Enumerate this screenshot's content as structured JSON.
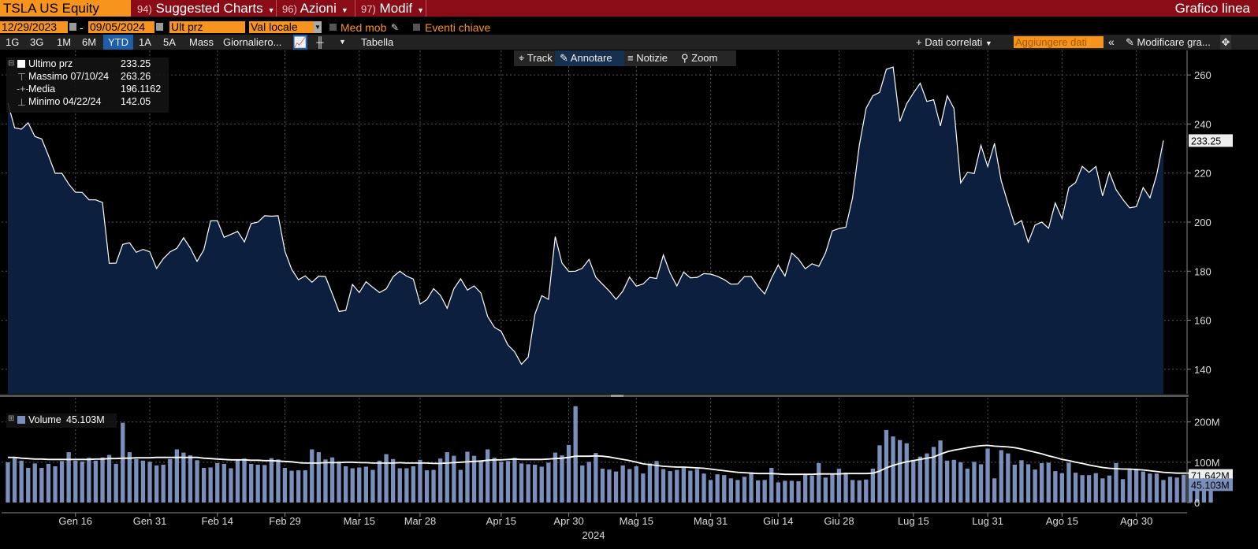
{
  "topbar": {
    "ticker": "TSLA US Equity",
    "menus": [
      {
        "num": "94)",
        "label": "Suggested Charts"
      },
      {
        "num": "96)",
        "label": "Azioni"
      },
      {
        "num": "97)",
        "label": "Modif"
      }
    ],
    "right_title": "Grafico linea"
  },
  "controls": {
    "start_date": "12/29/2023",
    "dash": "-",
    "end_date": "09/05/2024",
    "field": "Ult prz",
    "currency": "Val locale",
    "moving_avg": "Med mob",
    "key_events": "Eventi chiave"
  },
  "periods": [
    "1G",
    "3G",
    "1M",
    "6M",
    "YTD",
    "1A",
    "5A",
    "Mass"
  ],
  "selected_period": "YTD",
  "frequency": "Giornaliero...",
  "table_button": "Tabella",
  "related_data": "Dati correlati",
  "add_data_placeholder": "Aggiungere dati",
  "edit_chart": "Modificare gra...",
  "chart_tools": [
    "Track",
    "Annotare",
    "Notizie",
    "Zoom"
  ],
  "legend": {
    "last_label": "Ultimo prz",
    "last_value": "233.25",
    "high_label": "Massimo 07/10/24",
    "high_value": "263.26",
    "avg_label": "Media",
    "avg_value": "196.1162",
    "low_label": "Minimo 04/22/24",
    "low_value": "142.05"
  },
  "volume_legend": {
    "label": "Volume",
    "value": "45.103M"
  },
  "price_axis_ticks": [
    "260",
    "240",
    "220",
    "200",
    "180",
    "160",
    "140"
  ],
  "volume_axis_ticks": [
    "200M",
    "100M",
    "0"
  ],
  "x_ticks": [
    "Gen 16",
    "Gen 31",
    "Feb 14",
    "Feb 29",
    "Mar 15",
    "Mar 28",
    "Apr 15",
    "Apr 30",
    "Mag 15",
    "Mag 31",
    "Giu 14",
    "Giu 28",
    "Lug 15",
    "Lug 31",
    "Ago 15",
    "Ago 30"
  ],
  "x_year": "2024",
  "last_price_tag": "233.25",
  "volume_ma_tag": "71.642M",
  "volume_last_tag": "45.103M",
  "colors": {
    "area": "#0c1f3e",
    "line": "#ffffff",
    "bars": "#7b8fbd",
    "accent": "#f7941d",
    "topbar": "#8b0c16"
  },
  "chart_data": [
    {
      "type": "area",
      "series": [
        {
          "name": "Ultimo prz",
          "values": [
            248.5,
            238.4,
            237.9,
            240.5,
            234.9,
            233.9,
            227.2,
            219.9,
            219.9,
            215.5,
            212.2,
            212.1,
            209.1,
            209.1,
            208.0,
            183.2,
            183.3,
            190.9,
            191.6,
            187.7,
            188.9,
            187.9,
            181.1,
            185.1,
            187.9,
            189.3,
            193.6,
            189.4,
            184.0,
            188.7,
            200.5,
            200.5,
            193.8,
            195.0,
            196.2,
            191.9,
            199.4,
            200.0,
            202.6,
            202.4,
            202.6,
            188.1,
            180.7,
            176.5,
            178.1,
            175.5,
            178.0,
            177.8,
            170.8,
            163.6,
            164.0,
            174.6,
            171.3,
            175.7,
            173.4,
            171.3,
            172.8,
            177.7,
            180.0,
            178.0,
            176.8,
            166.6,
            168.4,
            172.9,
            170.2,
            164.9,
            172.8,
            176.9,
            172.3,
            174.0,
            171.1,
            161.5,
            157.1,
            155.5,
            149.9,
            147.1,
            142.05,
            145.0,
            162.5,
            170.0,
            168.5,
            194.1,
            183.3,
            179.9,
            180.0,
            181.2,
            184.8,
            177.5,
            174.7,
            171.9,
            168.5,
            171.9,
            177.6,
            173.9,
            174.8,
            177.5,
            177.0,
            186.6,
            179.2,
            174.0,
            179.6,
            177.3,
            177.5,
            179.0,
            178.8,
            177.9,
            176.6,
            174.7,
            174.8,
            177.8,
            177.8,
            173.8,
            170.7,
            177.2,
            182.5,
            178.0,
            187.4,
            184.9,
            181.0,
            183.0,
            182.0,
            187.4,
            196.4,
            197.4,
            197.9,
            209.9,
            231.3,
            246.4,
            251.5,
            252.9,
            262.3,
            263.26,
            241.0,
            248.2,
            252.6,
            256.6,
            249.2,
            249.9,
            239.2,
            251.5,
            246.4,
            215.99,
            220.3,
            219.8,
            231.3,
            222.6,
            232.1,
            216.9,
            207.7,
            198.9,
            200.6,
            191.8,
            198.8,
            200.0,
            197.5,
            207.8,
            201.4,
            214.1,
            216.1,
            222.7,
            220.3,
            222.7,
            210.7,
            220.3,
            213.2,
            209.2,
            205.8,
            206.3,
            214.1,
            209.9,
            219.2,
            233.25
          ]
        }
      ],
      "ylim": [
        130,
        270
      ],
      "x_start": "2023-12-29",
      "x_end": "2024-09-05"
    },
    {
      "type": "bar",
      "series": [
        {
          "name": "Volume",
          "values": [
            100,
            110,
            104,
            86,
            97,
            86,
            96,
            90,
            103,
            125,
            104,
            102,
            111,
            104,
            112,
            118,
            96,
            198,
            125,
            108,
            104,
            101,
            92,
            94,
            108,
            132,
            124,
            117,
            105,
            86,
            87,
            98,
            96,
            85,
            106,
            109,
            96,
            94,
            93,
            110,
            107,
            86,
            79,
            80,
            80,
            132,
            125,
            107,
            112,
            102,
            90,
            85,
            87,
            89,
            81,
            104,
            120,
            108,
            85,
            85,
            90,
            106,
            80,
            81,
            109,
            125,
            116,
            81,
            126,
            116,
            105,
            132,
            111,
            101,
            103,
            111,
            97,
            95,
            94,
            89,
            99,
            124,
            117,
            143,
            239,
            92,
            101,
            123,
            84,
            82,
            77,
            92,
            83,
            90,
            72,
            97,
            103,
            83,
            78,
            81,
            86,
            79,
            83,
            72,
            56,
            70,
            68,
            60,
            56,
            64,
            75,
            55,
            56,
            86,
            50,
            54,
            54,
            53,
            70,
            67,
            98,
            62,
            71,
            84,
            74,
            56,
            55,
            57,
            84,
            142,
            180,
            164,
            155,
            147,
            106,
            114,
            122,
            138,
            154,
            104,
            106,
            100,
            84,
            101,
            95,
            134,
            60,
            130,
            122,
            94,
            105,
            95,
            82,
            98,
            99,
            78,
            73,
            99,
            74,
            68,
            68,
            73,
            60,
            67,
            98,
            58,
            84,
            84,
            77,
            72,
            72,
            56,
            64,
            62,
            69,
            71,
            72,
            77,
            45.103
          ]
        },
        {
          "name": "Media mobile volume",
          "values": [
            112,
            112,
            110,
            109,
            108,
            108,
            107,
            107,
            107,
            107,
            107,
            107,
            107,
            108,
            108,
            109,
            109,
            110,
            110,
            111,
            111,
            111,
            112,
            112,
            112,
            112,
            112,
            112,
            112,
            110,
            109,
            108,
            107,
            106,
            106,
            106,
            105,
            105,
            104,
            104,
            103,
            102,
            101,
            99,
            98,
            98,
            98,
            99,
            99,
            99,
            100,
            100,
            99,
            99,
            98,
            98,
            98,
            98,
            99,
            98,
            98,
            98,
            98,
            97,
            97,
            98,
            99,
            100,
            101,
            102,
            103,
            105,
            106,
            106,
            107,
            108,
            107,
            107,
            107,
            107,
            108,
            109,
            110,
            112,
            115,
            115,
            115,
            116,
            115,
            113,
            110,
            107,
            104,
            100,
            96,
            94,
            92,
            90,
            89,
            88,
            88,
            87,
            86,
            85,
            83,
            81,
            79,
            77,
            75,
            74,
            73,
            72,
            72,
            72,
            71,
            70,
            70,
            70,
            70,
            70,
            71,
            71,
            71,
            71,
            72,
            72,
            72,
            72,
            73,
            78,
            86,
            92,
            97,
            101,
            104,
            107,
            110,
            113,
            120,
            126,
            130,
            133,
            136,
            139,
            141,
            142,
            140,
            139,
            138,
            136,
            133,
            129,
            125,
            121,
            116,
            112,
            107,
            104,
            100,
            97,
            93,
            90,
            87,
            85,
            84,
            83,
            83,
            82,
            81,
            79,
            77,
            75,
            74,
            73,
            73,
            73,
            73,
            72,
            71.642
          ]
        }
      ],
      "ylim": [
        0,
        260
      ]
    }
  ]
}
